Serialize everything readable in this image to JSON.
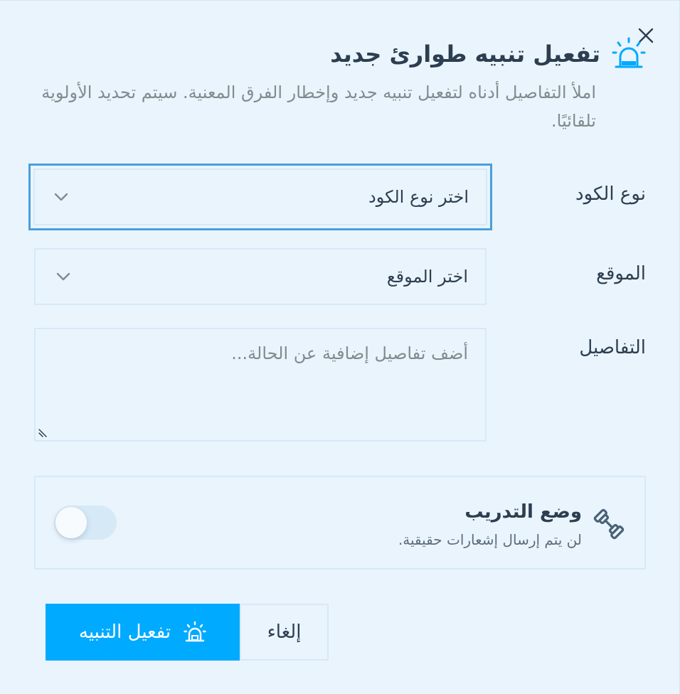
{
  "dialog": {
    "title": "تفعيل تنبيه طوارئ جديد",
    "subtitle": "املأ التفاصيل أدناه لتفعيل تنبيه جديد وإخطار الفرق المعنية. سيتم تحديد الأولوية تلقائيًا.",
    "header_icon": "siren-icon",
    "close_icon": "close-icon"
  },
  "form": {
    "code_type": {
      "label": "نوع الكود",
      "value": "اختر نوع الكود",
      "icon": "chevron-down-icon"
    },
    "location": {
      "label": "الموقع",
      "value": "اختر الموقع",
      "icon": "chevron-down-icon"
    },
    "details": {
      "label": "التفاصيل",
      "placeholder": "أضف تفاصيل إضافية عن الحالة..."
    }
  },
  "training_mode": {
    "title": "وضع التدريب",
    "description": "لن يتم إرسال إشعارات حقيقية.",
    "icon": "dumbbell-icon",
    "enabled": false
  },
  "actions": {
    "activate_label": "تفعيل التنبيه",
    "activate_icon": "siren-icon",
    "cancel_label": "إلغاء"
  },
  "colors": {
    "background": "#eaf4fd",
    "accent": "#00aaff",
    "focus_border": "#4a9fd8",
    "text": "#2c3e50",
    "muted": "#7f8c8d"
  }
}
